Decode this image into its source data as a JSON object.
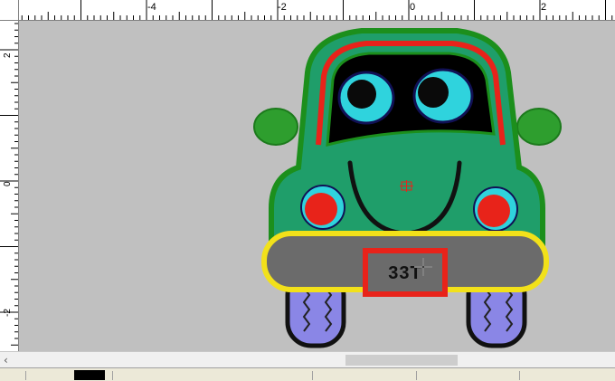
{
  "ruler": {
    "top_labels": [
      "-4",
      "-2",
      "0",
      "2"
    ],
    "left_labels": [
      "2",
      "0",
      "-2"
    ]
  },
  "design": {
    "plate_text": "33T",
    "colors": {
      "body": "#1f9e6a",
      "outline": "#1c8f1c",
      "roof_stripe": "#e8231a",
      "window": "#000000",
      "eye": "#2fd3dd",
      "cheek": "#e8231a",
      "bumper": "#f2e11a",
      "bumper_fill": "#6b6b6b",
      "tire": "#8a86e6",
      "plate": "#e8231a"
    }
  },
  "canvas": {
    "background": "#c0c0c0"
  },
  "statusbar": {
    "color_swatch": "#000000"
  }
}
